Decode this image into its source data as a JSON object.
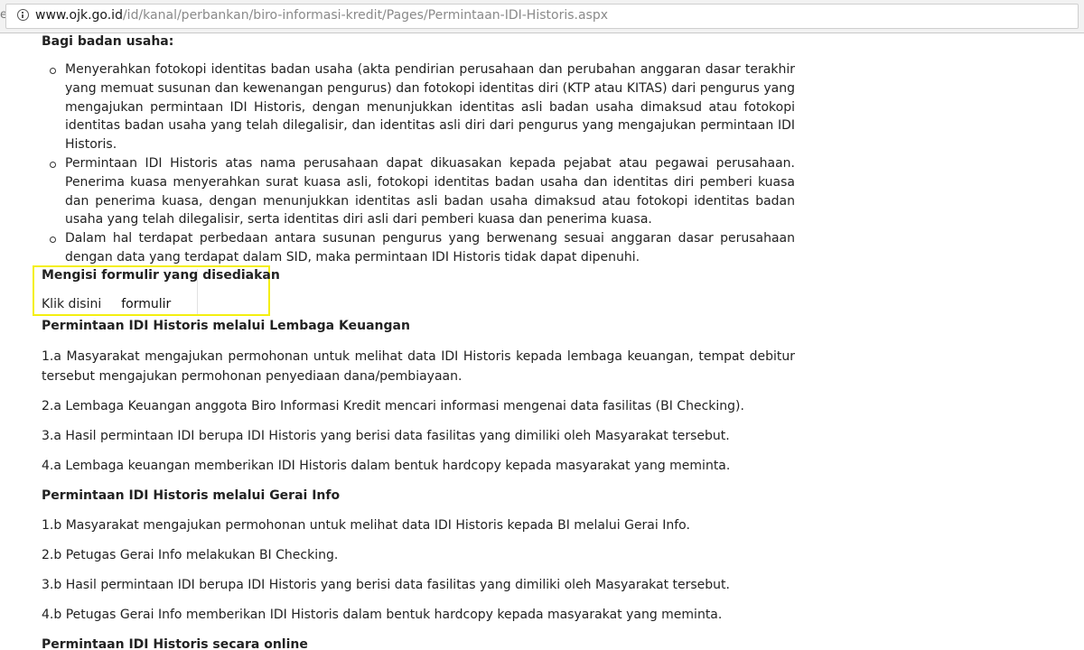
{
  "browser": {
    "url_host": "www.ojk.go.id",
    "url_path": "/id/kanal/perbankan/biro-informasi-kredit/Pages/Permintaan-IDI-Historis.aspx"
  },
  "badan_usaha": {
    "heading": "Bagi badan usaha:",
    "bullets": [
      "Menyerahkan fotokopi identitas badan usaha (akta pendirian perusahaan dan perubahan anggaran dasar terakhir yang memuat susunan dan kewenangan pengurus) dan fotokopi identitas diri (KTP atau KITAS) dari pengurus yang mengajukan permintaan IDI Historis, dengan menunjukkan identitas asli badan usaha dimaksud atau fotokopi identitas badan usaha yang telah dilegalisir, dan identitas asli diri dari pengurus yang mengajukan permintaan IDI Historis.",
      "Permintaan IDI Historis atas nama perusahaan dapat dikuasakan kepada pejabat atau pegawai perusahaan. Penerima kuasa menyerahkan surat kuasa asli, fotokopi identitas badan usaha dan identitas diri pemberi kuasa dan penerima kuasa, dengan menunjukkan identitas asli badan usaha dimaksud atau fotokopi identitas badan usaha yang telah dilegalisir, serta identitas diri asli dari pemberi kuasa dan penerima kuasa.",
      "Dalam hal terdapat perbedaan antara susunan pengurus yang berwenang sesuai anggaran dasar perusahaan dengan data yang terdapat dalam SID, maka permintaan IDI Historis tidak dapat dipenuhi."
    ]
  },
  "formulir": {
    "heading": "Mengisi formulir yang disediakan",
    "klik_label": "Klik disini",
    "link_text": "formulir",
    "highlight_color": "#f4ef10"
  },
  "lembaga_keuangan": {
    "heading": "Permintaan IDI Historis melalui Lembaga Keuangan",
    "steps": [
      "1.a Masyarakat mengajukan permohonan untuk melihat data IDI Historis kepada lembaga keuangan, tempat debitur tersebut mengajukan permohonan penyediaan dana/pembiayaan.",
      "2.a Lembaga Keuangan anggota Biro Informasi Kredit mencari informasi mengenai data fasilitas (BI Checking).",
      "3.a Hasil permintaan IDI berupa IDI Historis yang berisi data fasilitas yang dimiliki oleh Masyarakat tersebut.",
      "4.a Lembaga keuangan memberikan IDI Historis dalam bentuk hardcopy kepada masyarakat yang meminta."
    ]
  },
  "gerai_info": {
    "heading": "Permintaan IDI Historis melalui Gerai Info",
    "steps": [
      "1.b Masyarakat mengajukan permohonan untuk melihat data IDI Historis kepada BI melalui Gerai Info.",
      "2.b Petugas Gerai Info melakukan BI Checking.",
      "3.b Hasil permintaan IDI berupa IDI Historis yang berisi data fasilitas yang dimiliki oleh Masyarakat tersebut.",
      "4.b Petugas Gerai Info memberikan IDI Historis dalam bentuk hardcopy kepada masyarakat yang meminta."
    ]
  },
  "online": {
    "heading": "Permintaan IDI Historis secara online"
  }
}
